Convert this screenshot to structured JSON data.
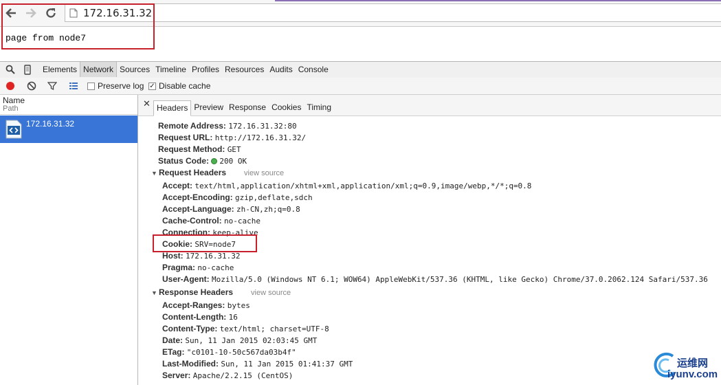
{
  "browser": {
    "url": "172.16.31.32",
    "accent_color": "#8a6fb5"
  },
  "page": {
    "body_text": "page from node7"
  },
  "devtools": {
    "tabs": [
      {
        "label": "Elements"
      },
      {
        "label": "Network",
        "active": true
      },
      {
        "label": "Sources"
      },
      {
        "label": "Timeline"
      },
      {
        "label": "Profiles"
      },
      {
        "label": "Resources"
      },
      {
        "label": "Audits"
      },
      {
        "label": "Console"
      }
    ],
    "network_toolbar": {
      "preserve_log_label": "Preserve log",
      "preserve_log_checked": false,
      "disable_cache_label": "Disable cache",
      "disable_cache_checked": true,
      "record_color": "#e02424"
    },
    "request_list": {
      "col_name": "Name",
      "col_path": "Path",
      "requests": [
        {
          "name": "172.16.31.32",
          "selected": true
        }
      ],
      "selected_color": "#3875d7"
    },
    "detail_tabs": [
      {
        "label": "Headers",
        "active": true
      },
      {
        "label": "Preview"
      },
      {
        "label": "Response"
      },
      {
        "label": "Cookies"
      },
      {
        "label": "Timing"
      }
    ],
    "general": {
      "remote_address": {
        "key": "Remote Address:",
        "value": "172.16.31.32:80"
      },
      "request_url": {
        "key": "Request URL:",
        "value": "http://172.16.31.32/"
      },
      "request_method": {
        "key": "Request Method:",
        "value": "GET"
      },
      "status_code": {
        "key": "Status Code:",
        "value": "200 OK"
      }
    },
    "request_headers": {
      "title": "Request Headers",
      "view_source": "view source",
      "items": [
        {
          "key": "Accept:",
          "value": "text/html,application/xhtml+xml,application/xml;q=0.9,image/webp,*/*;q=0.8"
        },
        {
          "key": "Accept-Encoding:",
          "value": "gzip,deflate,sdch"
        },
        {
          "key": "Accept-Language:",
          "value": "zh-CN,zh;q=0.8"
        },
        {
          "key": "Cache-Control:",
          "value": "no-cache"
        },
        {
          "key": "Connection:",
          "value": "keep-alive"
        },
        {
          "key": "Cookie:",
          "value": "SRV=node7"
        },
        {
          "key": "Host:",
          "value": "172.16.31.32"
        },
        {
          "key": "Pragma:",
          "value": "no-cache"
        },
        {
          "key": "User-Agent:",
          "value": "Mozilla/5.0 (Windows NT 6.1; WOW64) AppleWebKit/537.36 (KHTML, like Gecko) Chrome/37.0.2062.124 Safari/537.36"
        }
      ]
    },
    "response_headers": {
      "title": "Response Headers",
      "view_source": "view source",
      "items": [
        {
          "key": "Accept-Ranges:",
          "value": "bytes"
        },
        {
          "key": "Content-Length:",
          "value": "16"
        },
        {
          "key": "Content-Type:",
          "value": "text/html; charset=UTF-8"
        },
        {
          "key": "Date:",
          "value": "Sun, 11 Jan 2015 02:03:45 GMT"
        },
        {
          "key": "ETag:",
          "value": "\"c0101-10-50c567da03b4f\""
        },
        {
          "key": "Last-Modified:",
          "value": "Sun, 11 Jan 2015 01:41:37 GMT"
        },
        {
          "key": "Server:",
          "value": "Apache/2.2.15 (CentOS)"
        }
      ]
    }
  },
  "watermark": {
    "text_cn": "运维网",
    "text_domain": "iyunv.com"
  },
  "annotation_color": "#c8202a"
}
